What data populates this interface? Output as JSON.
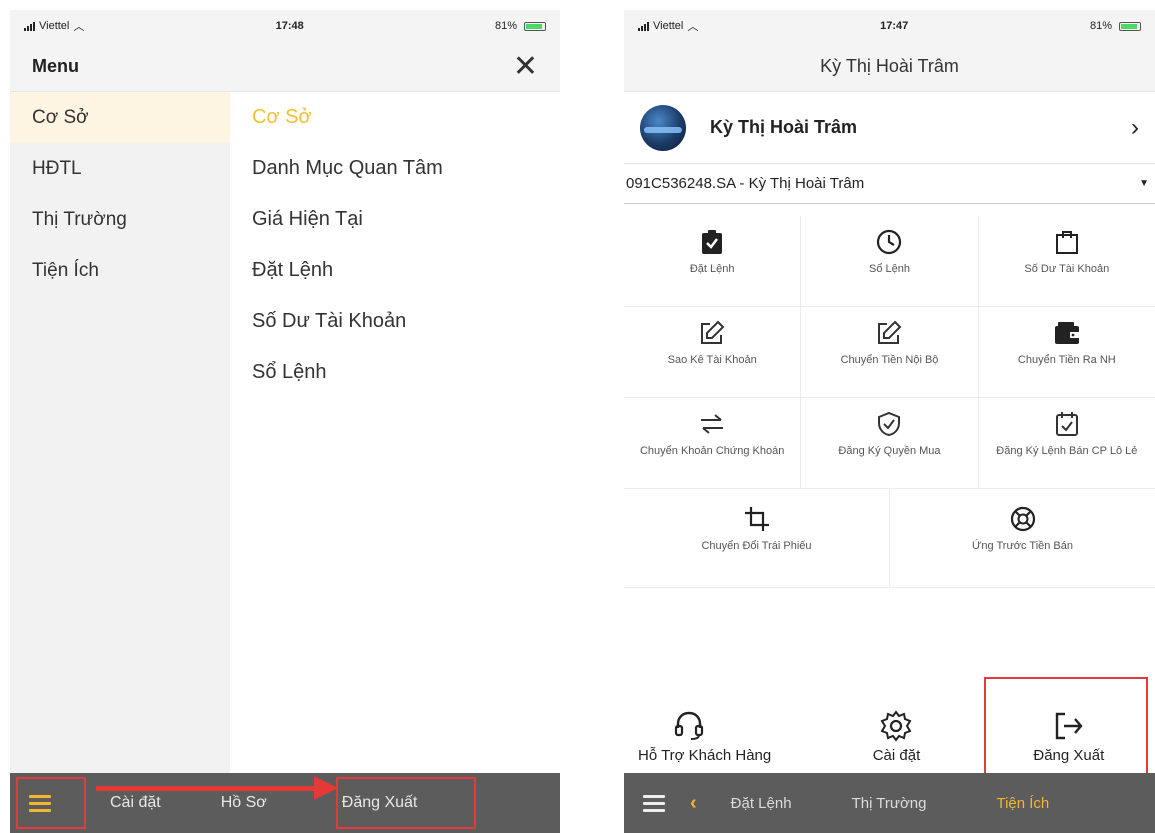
{
  "left": {
    "status": {
      "carrier": "Viettel",
      "time": "17:48",
      "battery": "81%"
    },
    "menu_title": "Menu",
    "categories": [
      "Cơ Sở",
      "HĐTL",
      "Thị Trường",
      "Tiện Ích"
    ],
    "submenu": [
      "Cơ Sở",
      "Danh Mục Quan Tâm",
      "Giá Hiện Tại",
      "Đặt Lệnh",
      "Số Dư Tài Khoản",
      "Sổ Lệnh"
    ],
    "bottom": {
      "settings": "Cài đặt",
      "profile": "Hồ Sơ",
      "logout": "Đăng Xuất"
    }
  },
  "right": {
    "status": {
      "carrier": "Viettel",
      "time": "17:47",
      "battery": "81%"
    },
    "nav_title": "Kỳ Thị Hoài Trâm",
    "profile_name": "Kỳ Thị Hoài Trâm",
    "account": "091C536248.SA - Kỳ Thị Hoài Trâm",
    "grid": [
      [
        "Đặt Lệnh",
        "Sổ Lệnh",
        "Số Dư Tài Khoản"
      ],
      [
        "Sao Kê Tài Khoản",
        "Chuyển Tiền Nội Bộ",
        "Chuyển Tiền Ra NH"
      ],
      [
        "Chuyển Khoản Chứng Khoán",
        "Đăng Ký Quyền Mua",
        "Đăng Ký Lệnh Bán CP Lô Lẻ"
      ],
      [
        "Chuyển Đổi Trái Phiếu",
        "Ứng Trước Tiền Bán"
      ]
    ],
    "bottom_actions": {
      "support": "Hỗ Trợ Khách Hàng",
      "settings": "Cài đặt",
      "logout": "Đăng Xuất"
    },
    "tabs": [
      "Đặt Lệnh",
      "Thị Trường",
      "Tiện Ích"
    ]
  },
  "colors": {
    "accent": "#f2b632",
    "highlight_red": "#e03c3c",
    "bar": "#5c5c5c"
  }
}
